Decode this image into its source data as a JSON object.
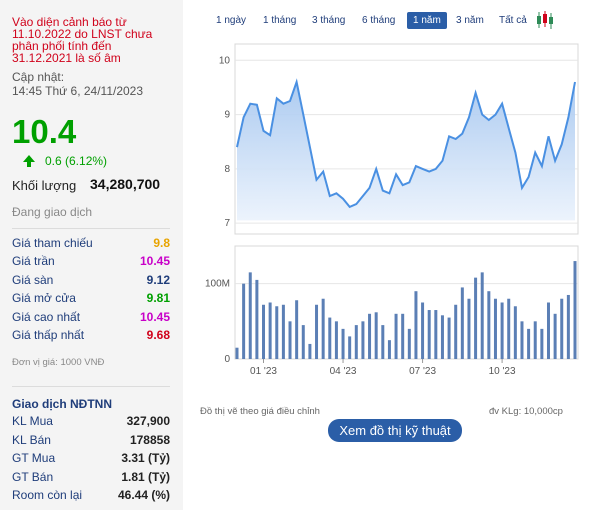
{
  "warning": "Vào diện cảnh báo từ 11.10.2022 do LNST chưa phân phối tính đến 31.12.2021 là số âm",
  "update_label": "Cập nhật:",
  "update_time": "14:45 Thứ 6, 24/11/2023",
  "price": "10.4",
  "change": "0.6 (6.12%)",
  "volume_label": "Khối lượng",
  "volume_value": "34,280,700",
  "status": "Đang giao dịch",
  "prices": [
    {
      "label": "Giá tham chiếu",
      "value": "9.8",
      "color": "#e8a400"
    },
    {
      "label": "Giá trần",
      "value": "10.45",
      "color": "#c800c8"
    },
    {
      "label": "Giá sàn",
      "value": "9.12",
      "color": "#1f3d7a"
    },
    {
      "label": "Giá mở cửa",
      "value": "9.81",
      "color": "#00a000"
    },
    {
      "label": "Giá cao nhất",
      "value": "10.45",
      "color": "#c800c8"
    },
    {
      "label": "Giá thấp nhất",
      "value": "9.68",
      "color": "#d0021b"
    }
  ],
  "unit_note": "Đơn vị giá: 1000 VNĐ",
  "ndtnn_title": "Giao dịch NĐTNN",
  "ndtnn": [
    {
      "label": "KL Mua",
      "value": "327,900"
    },
    {
      "label": "KL Bán",
      "value": "178858"
    },
    {
      "label": "GT Mua",
      "value": "3.31 (Tỷ)"
    },
    {
      "label": "GT Bán",
      "value": "1.81 (Tỷ)"
    },
    {
      "label": "Room còn lại",
      "value": "46.44 (%)"
    }
  ],
  "tabs": [
    "1 ngày",
    "1 tháng",
    "3 tháng",
    "6 tháng",
    "1 năm",
    "3 năm",
    "Tất cả"
  ],
  "active_tab": "1 năm",
  "candlestick_icon": "candlestick-icon",
  "footnote_left": "Đồ thị vẽ theo giá điều chỉnh",
  "footnote_right": "đv KLg: 10,000cp",
  "tech_button": "Xem đồ thị kỹ thuật",
  "colors": {
    "up": "#00a000",
    "accent": "#2b5ea7",
    "line": "#4a90e2",
    "area_top": "#a8c8f0",
    "bar": "#5b7fb5"
  },
  "chart_data": {
    "type": "area",
    "price_axis": {
      "ticks": [
        "7",
        "8",
        "9",
        "10"
      ],
      "ylim": [
        6.8,
        10.3
      ]
    },
    "volume_axis": {
      "ticks": [
        "0",
        "100M"
      ],
      "ylim": [
        0,
        150
      ]
    },
    "x_ticks": [
      "01 '23",
      "04 '23",
      "07 '23",
      "10 '23"
    ],
    "x_tick_index": [
      4,
      16,
      28,
      40
    ],
    "grid": true,
    "price": [
      8.4,
      8.95,
      9.2,
      9.18,
      8.7,
      8.62,
      9.3,
      9.2,
      9.25,
      9.6,
      9.0,
      8.4,
      7.8,
      7.95,
      7.5,
      7.55,
      7.45,
      7.3,
      7.35,
      7.5,
      7.65,
      8.0,
      7.6,
      7.55,
      7.9,
      7.7,
      7.75,
      8.05,
      8.0,
      7.95,
      8.0,
      8.15,
      8.6,
      8.55,
      8.65,
      8.95,
      9.4,
      9.0,
      8.9,
      9.0,
      9.2,
      8.75,
      8.3,
      7.65,
      7.85,
      8.3,
      8.05,
      8.6,
      8.15,
      8.45,
      8.95,
      9.6
    ],
    "volume": [
      15,
      100,
      115,
      105,
      72,
      75,
      70,
      72,
      50,
      78,
      45,
      20,
      72,
      80,
      55,
      50,
      40,
      30,
      45,
      50,
      60,
      62,
      45,
      25,
      60,
      60,
      40,
      90,
      75,
      65,
      65,
      58,
      55,
      72,
      95,
      80,
      108,
      115,
      90,
      80,
      75,
      80,
      70,
      50,
      40,
      50,
      40,
      75,
      60,
      80,
      85,
      130
    ]
  }
}
